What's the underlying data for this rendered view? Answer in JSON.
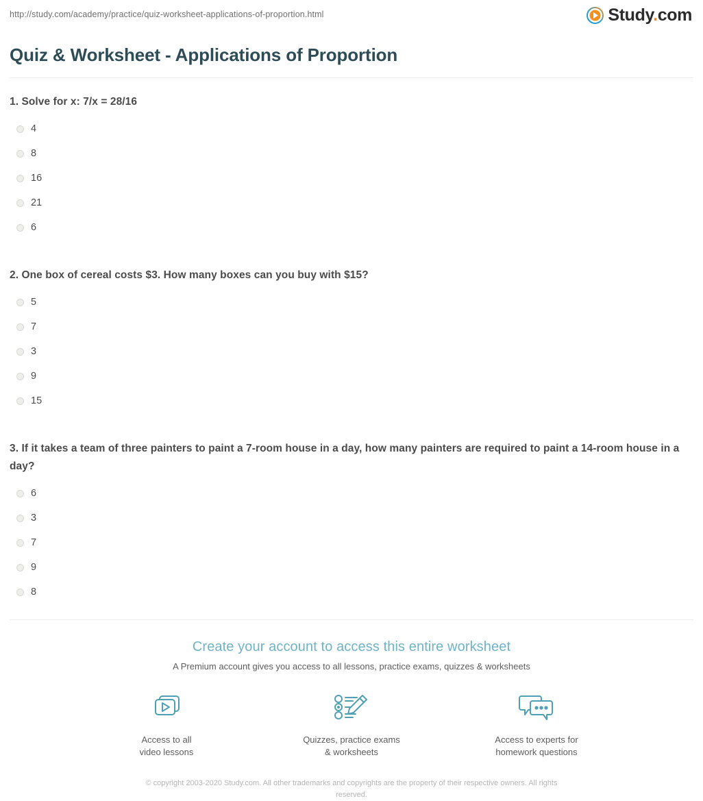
{
  "browser": {
    "url": "http://study.com/academy/practice/quiz-worksheet-applications-of-proportion.html"
  },
  "brand": {
    "name": "Study",
    "dot": ".",
    "suffix": "com",
    "icon": "play-circle-icon",
    "colors": {
      "icon_orange": "#f4901e",
      "icon_blue": "#1f9bd1",
      "dot_orange": "#f08a24",
      "wordmark": "#2b2b2b"
    }
  },
  "header": {
    "title": "Quiz & Worksheet - Applications of Proportion",
    "title_color": "#2e4c56"
  },
  "questions": [
    {
      "number": "1.",
      "text": "1. Solve for x: 7/x = 28/16",
      "options": [
        "4",
        "8",
        "16",
        "21",
        "6"
      ]
    },
    {
      "number": "2.",
      "text": "2. One box of cereal costs $3. How many boxes can you buy with $15?",
      "options": [
        "5",
        "7",
        "3",
        "9",
        "15"
      ]
    },
    {
      "number": "3.",
      "text": "3. If it takes a team of three painters to paint a 7-room house in a day, how many painters are required to paint a 14-room house in a day?",
      "options": [
        "6",
        "3",
        "7",
        "9",
        "8"
      ]
    }
  ],
  "cta": {
    "title": "Create your account to access this entire worksheet",
    "title_color": "#6fb3c6",
    "subtitle": "A Premium account gives you access to all lessons, practice exams, quizzes & worksheets",
    "features": [
      {
        "icon": "video-lessons-icon",
        "label": "Access to all\nvideo lessons"
      },
      {
        "icon": "quiz-pencil-icon",
        "label": "Quizzes, practice exams\n& worksheets"
      },
      {
        "icon": "speech-bubbles-icon",
        "label": "Access to experts for\nhomework questions"
      }
    ]
  },
  "footer": {
    "copyright": "© copyright 2003-2020 Study.com. All other trademarks and copyrights are the property of their respective owners. All rights reserved."
  }
}
